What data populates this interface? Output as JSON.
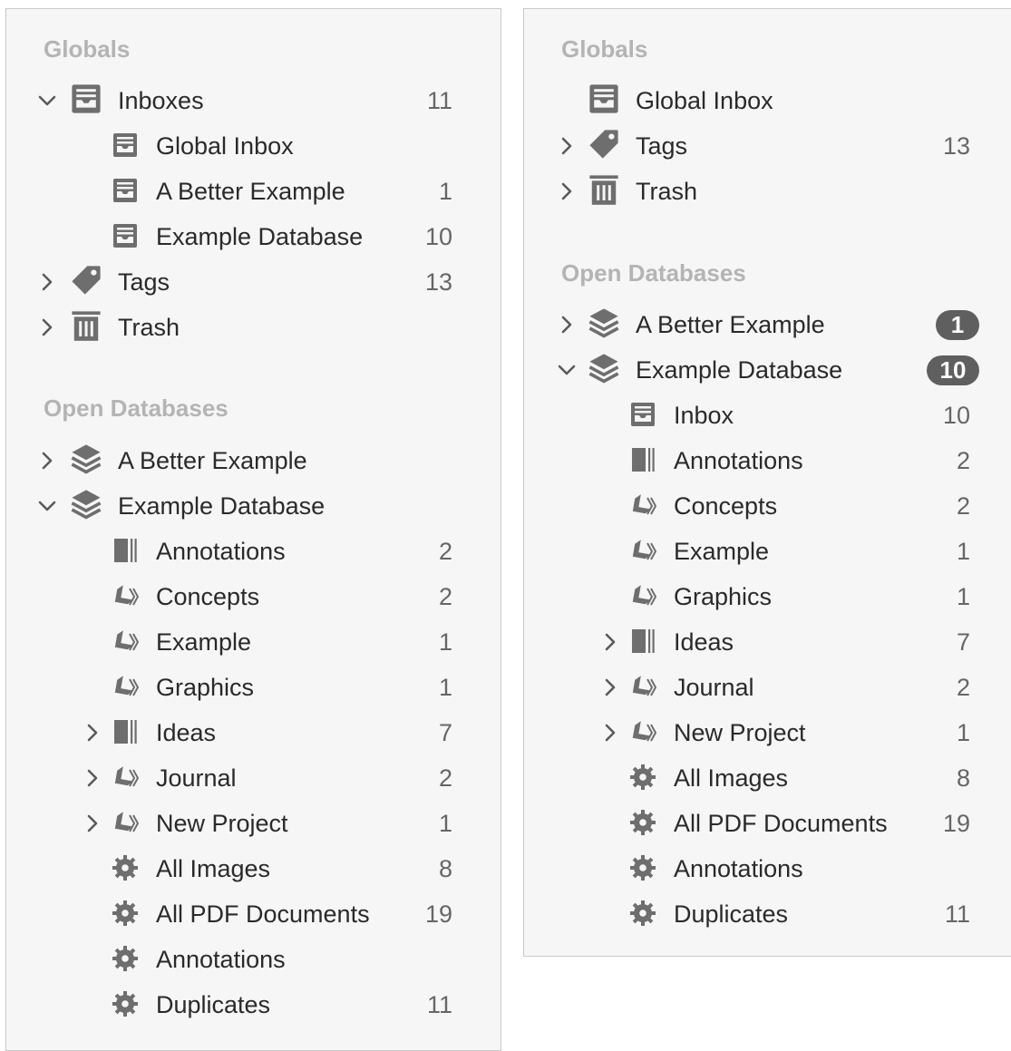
{
  "left_panel": {
    "globals_header": "Globals",
    "open_databases_header": "Open Databases",
    "globals": [
      {
        "label": "Inboxes",
        "count": "11",
        "icon": "inbox-icon",
        "chevron": "down",
        "level": 0
      },
      {
        "label": "Global Inbox",
        "count": "",
        "icon": "inbox-icon",
        "chevron": "",
        "level": 1
      },
      {
        "label": "A Better Example",
        "count": "1",
        "icon": "inbox-icon",
        "chevron": "",
        "level": 1
      },
      {
        "label": "Example Database",
        "count": "10",
        "icon": "inbox-icon",
        "chevron": "",
        "level": 1
      },
      {
        "label": "Tags",
        "count": "13",
        "icon": "tag-icon",
        "chevron": "right",
        "level": 0
      },
      {
        "label": "Trash",
        "count": "",
        "icon": "trash-icon",
        "chevron": "right",
        "level": 0
      }
    ],
    "databases": [
      {
        "label": "A Better Example",
        "count": "",
        "icon": "database-icon",
        "chevron": "right",
        "level": 0
      },
      {
        "label": "Example Database",
        "count": "",
        "icon": "database-icon",
        "chevron": "down",
        "level": 0
      },
      {
        "label": "Annotations",
        "count": "2",
        "icon": "group-icon",
        "chevron": "",
        "level": 1
      },
      {
        "label": "Concepts",
        "count": "2",
        "icon": "tags-group-icon",
        "chevron": "",
        "level": 1
      },
      {
        "label": "Example",
        "count": "1",
        "icon": "tags-group-icon",
        "chevron": "",
        "level": 1
      },
      {
        "label": "Graphics",
        "count": "1",
        "icon": "tags-group-icon",
        "chevron": "",
        "level": 1
      },
      {
        "label": "Ideas",
        "count": "7",
        "icon": "group-icon",
        "chevron": "right",
        "level": 1
      },
      {
        "label": "Journal",
        "count": "2",
        "icon": "tags-group-icon",
        "chevron": "right",
        "level": 1
      },
      {
        "label": "New Project",
        "count": "1",
        "icon": "tags-group-icon",
        "chevron": "right",
        "level": 1
      },
      {
        "label": "All Images",
        "count": "8",
        "icon": "smart-group-gear-icon",
        "chevron": "",
        "level": 1
      },
      {
        "label": "All PDF Documents",
        "count": "19",
        "icon": "smart-group-gear-icon",
        "chevron": "",
        "level": 1
      },
      {
        "label": "Annotations",
        "count": "",
        "icon": "smart-group-gear-icon",
        "chevron": "",
        "level": 1
      },
      {
        "label": "Duplicates",
        "count": "11",
        "icon": "smart-group-gear-icon",
        "chevron": "",
        "level": 1
      }
    ]
  },
  "right_panel": {
    "globals_header": "Globals",
    "open_databases_header": "Open Databases",
    "globals": [
      {
        "label": "Global Inbox",
        "count": "",
        "icon": "inbox-icon",
        "chevron": "none"
      },
      {
        "label": "Tags",
        "count": "13",
        "icon": "tag-icon",
        "chevron": "right"
      },
      {
        "label": "Trash",
        "count": "",
        "icon": "trash-icon",
        "chevron": "right"
      }
    ],
    "databases": [
      {
        "label": "A Better Example",
        "badge": "1",
        "icon": "database-icon",
        "chevron": "right",
        "level": 0
      },
      {
        "label": "Example Database",
        "badge": "10",
        "icon": "database-icon",
        "chevron": "down",
        "level": 0
      },
      {
        "label": "Inbox",
        "count": "10",
        "icon": "inbox-icon",
        "chevron": "",
        "level": 1
      },
      {
        "label": "Annotations",
        "count": "2",
        "icon": "group-icon",
        "chevron": "",
        "level": 1
      },
      {
        "label": "Concepts",
        "count": "2",
        "icon": "tags-group-icon",
        "chevron": "",
        "level": 1
      },
      {
        "label": "Example",
        "count": "1",
        "icon": "tags-group-icon",
        "chevron": "",
        "level": 1
      },
      {
        "label": "Graphics",
        "count": "1",
        "icon": "tags-group-icon",
        "chevron": "",
        "level": 1
      },
      {
        "label": "Ideas",
        "count": "7",
        "icon": "group-icon",
        "chevron": "right",
        "level": 1
      },
      {
        "label": "Journal",
        "count": "2",
        "icon": "tags-group-icon",
        "chevron": "right",
        "level": 1
      },
      {
        "label": "New Project",
        "count": "1",
        "icon": "tags-group-icon",
        "chevron": "right",
        "level": 1
      },
      {
        "label": "All Images",
        "count": "8",
        "icon": "smart-group-gear-icon",
        "chevron": "",
        "level": 1
      },
      {
        "label": "All PDF Documents",
        "count": "19",
        "icon": "smart-group-gear-icon",
        "chevron": "",
        "level": 1
      },
      {
        "label": "Annotations",
        "count": "",
        "icon": "smart-group-gear-icon",
        "chevron": "",
        "level": 1
      },
      {
        "label": "Duplicates",
        "count": "11",
        "icon": "smart-group-gear-icon",
        "chevron": "",
        "level": 1
      }
    ]
  },
  "colors": {
    "panel_bg": "#f6f6f6",
    "header_text": "#b4b4b4",
    "icon": "#6e6e6e",
    "badge_bg": "#5f5f5f"
  }
}
